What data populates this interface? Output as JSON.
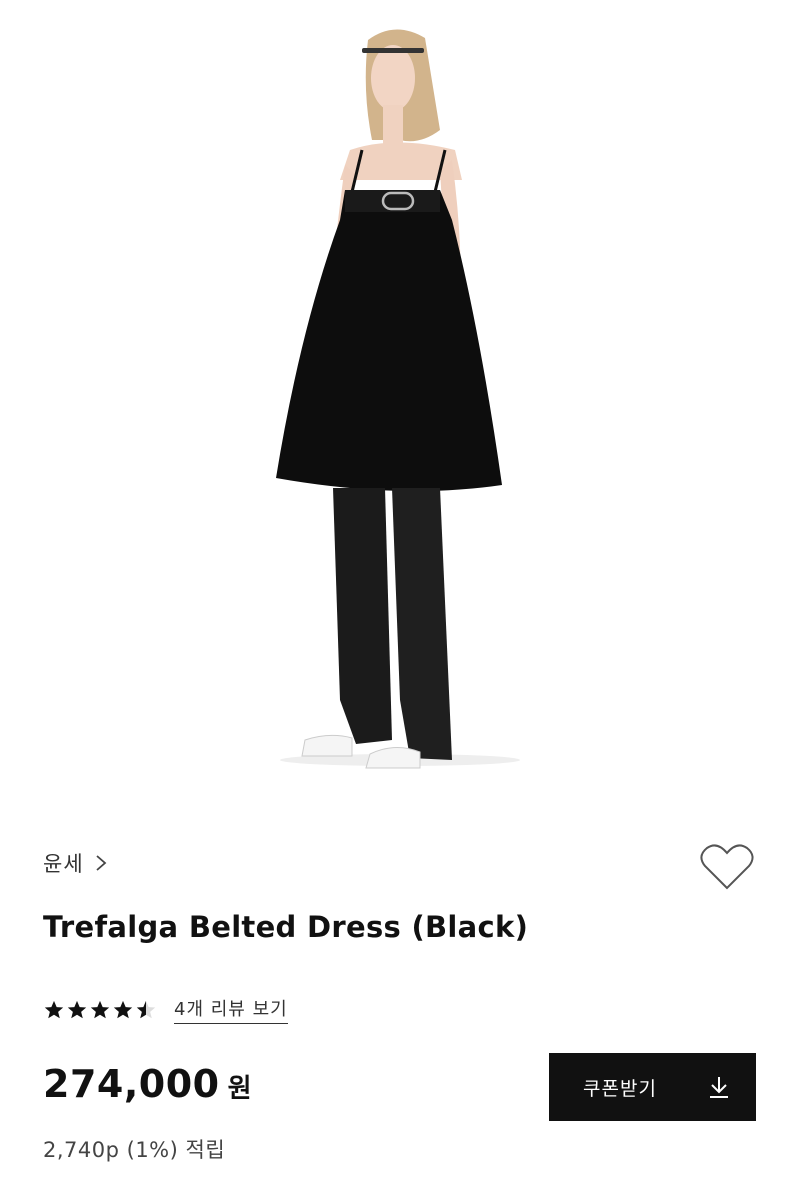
{
  "product_image": {
    "alt": "model-wearing-black-dress",
    "icon": "product-photo"
  },
  "brand": {
    "name": "윤세",
    "chevron_icon": "chevron-right-icon"
  },
  "wishlist": {
    "icon": "heart-outline-icon"
  },
  "product": {
    "title": "Trefalga Belted Dress (Black)"
  },
  "rating": {
    "value": 4.5,
    "max": 5,
    "review_link": "4개 리뷰 보기",
    "star_color": "#111111"
  },
  "pricing": {
    "price": "274,000",
    "currency": "원",
    "points_note": "2,740p (1%) 적립"
  },
  "coupon_button": {
    "label": "쿠폰받기",
    "icon": "download-icon",
    "background": "#111111"
  }
}
